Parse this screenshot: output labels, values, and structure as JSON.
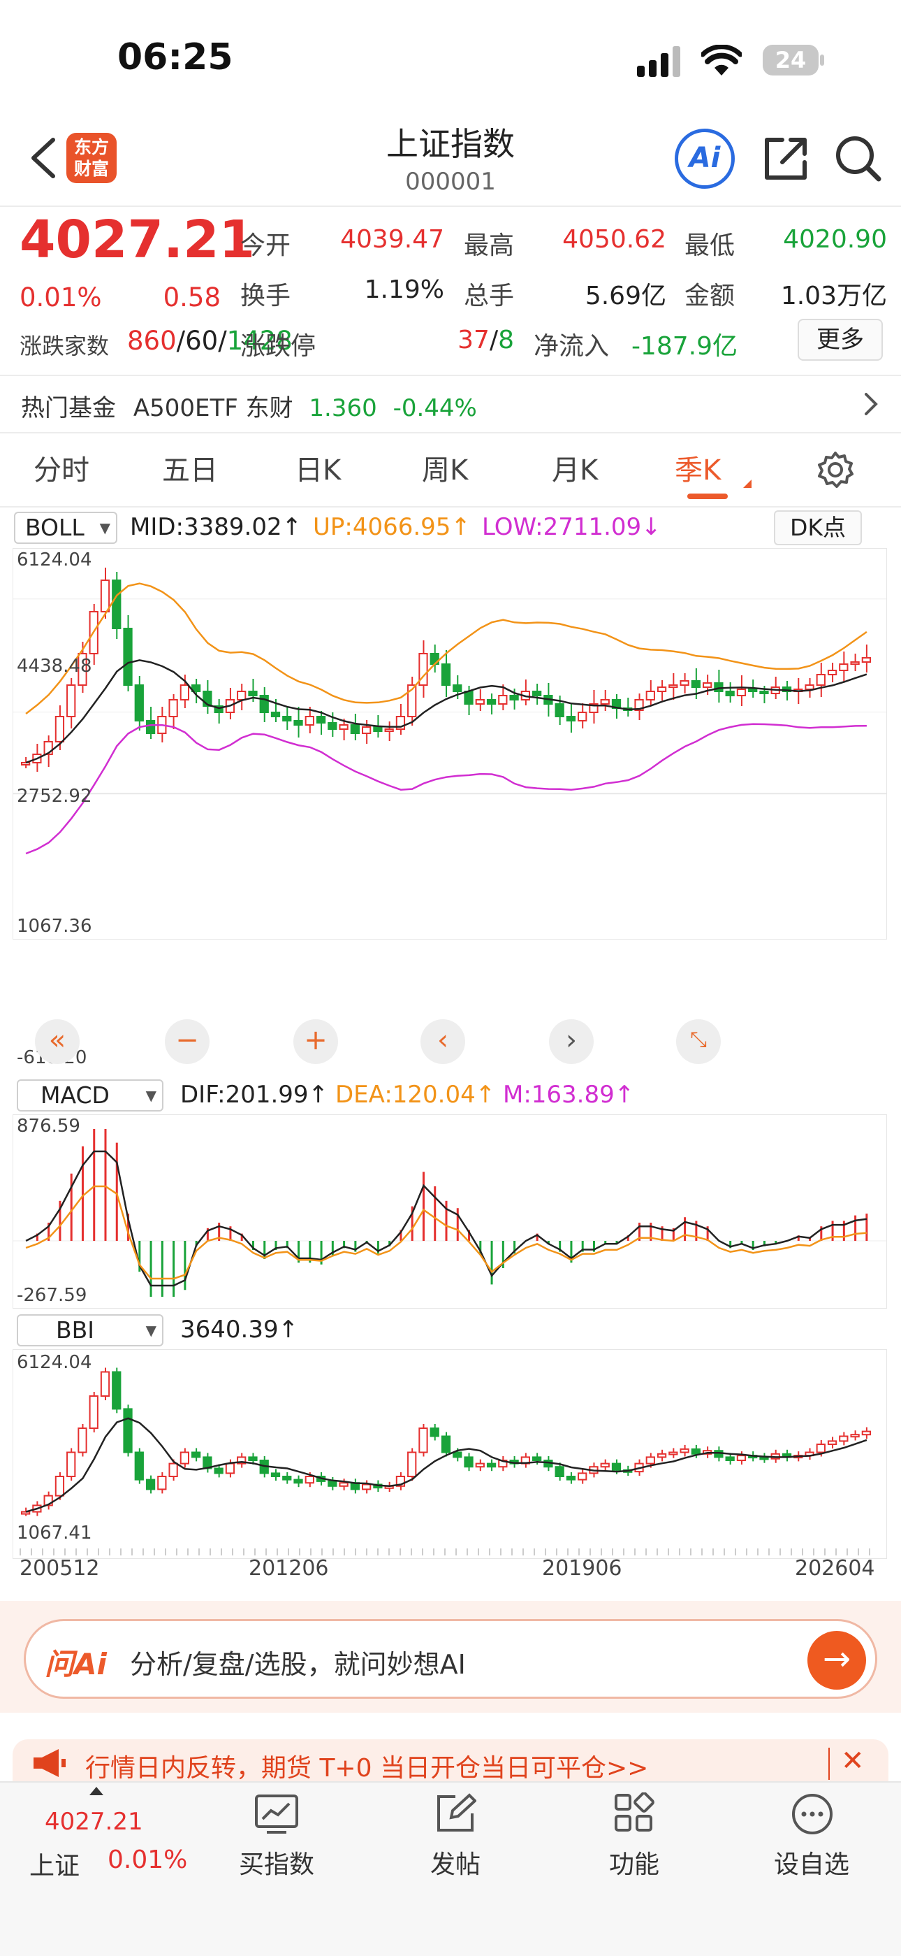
{
  "status_bar": {
    "time": "06:25",
    "battery": "24"
  },
  "header": {
    "logo_text_1": "东方",
    "logo_text_2": "财富",
    "title": "上证指数",
    "code": "000001",
    "ai_label": "Ai"
  },
  "quote": {
    "price": "4027.21",
    "change_pct": "0.01%",
    "change_abs": "0.58",
    "open_label": "今开",
    "open": "4039.47",
    "high_label": "最高",
    "high": "4050.62",
    "low_label": "最低",
    "low": "4020.90",
    "turnover_label": "换手",
    "turnover": "1.19%",
    "volume_label": "总手",
    "volume": "5.69亿",
    "amount_label": "金额",
    "amount": "1.03万亿",
    "breadth_label": "涨跌家数",
    "breadth_up": "860",
    "breadth_flat": "60",
    "breadth_down": "1428",
    "sep": "/",
    "limit_label": "涨跌停",
    "limit_up": "37",
    "limit_down": "8",
    "inflow_label": "净流入",
    "inflow": "-187.9亿",
    "more_label": "更多"
  },
  "fund": {
    "label": "热门基金",
    "name": "A500ETF 东财",
    "price": "1.360",
    "change": "-0.44%"
  },
  "tabs": [
    "分时",
    "五日",
    "日K",
    "周K",
    "月K",
    "季K"
  ],
  "active_tab": "季K",
  "main_chart": {
    "indicator": "BOLL",
    "mid": "MID:3389.02",
    "up": "UP:4066.95",
    "low": "LOW:2711.09",
    "dk_label": "DK点",
    "y_labels": [
      "6124.04",
      "4438.48",
      "2752.92",
      "1067.36",
      "-618.20"
    ]
  },
  "macd_chart": {
    "indicator": "MACD",
    "dif": "DIF:201.99",
    "dea": "DEA:120.04",
    "m": "M:163.89",
    "y_labels": [
      "876.59",
      "-267.59"
    ]
  },
  "bbi_chart": {
    "indicator": "BBI",
    "value": "3640.39",
    "y_labels": [
      "6124.04",
      "1067.41"
    ],
    "x_labels": [
      "200512",
      "201206",
      "201906",
      "202604"
    ]
  },
  "chart_data": {
    "type": "candlestick",
    "period": "quarterly",
    "y_range": [
      -618.2,
      6124.04
    ],
    "x_range": [
      "200512",
      "202604"
    ],
    "mid": 3389.02,
    "upper": 4066.95,
    "lower": 2711.09,
    "macd": {
      "dif": 201.99,
      "dea": 120.04,
      "m": 163.89
    },
    "bbi": 3640.39
  },
  "ask_ai": {
    "brand": "问Ai",
    "placeholder": "分析/复盘/选股，就问妙想AI"
  },
  "notice": {
    "text": "行情日内反转，期货 T+0 当日开仓当日可平仓>>"
  },
  "bottom_nav": {
    "index_price": "4027.21",
    "index_name": "上证",
    "index_change": "0.01%",
    "items": [
      "买指数",
      "发帖",
      "功能",
      "设自选"
    ]
  },
  "colors": {
    "up": "#e5302f",
    "down": "#19a33a",
    "mid_line": "#222222",
    "up_band": "#f29318",
    "low_band": "#d12ed1",
    "accent": "#ef5a20"
  }
}
